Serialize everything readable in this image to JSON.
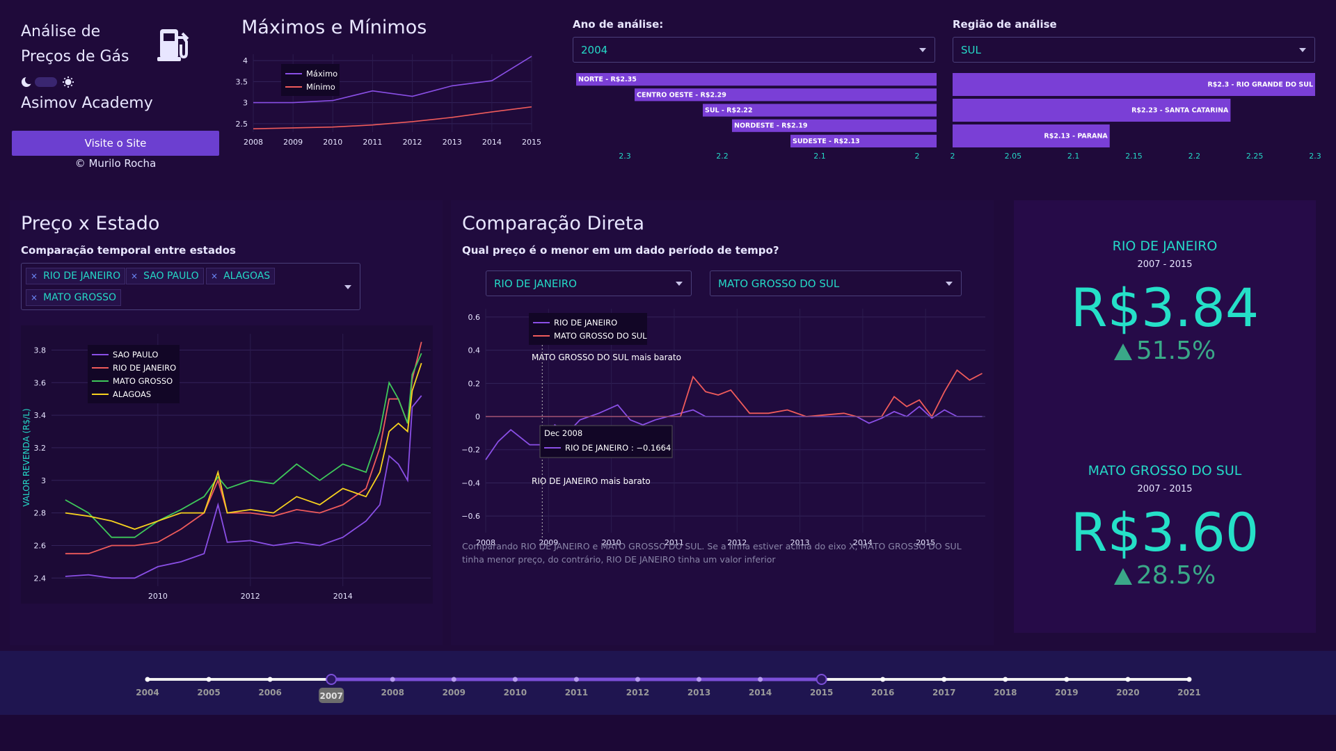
{
  "app": {
    "title": "Análise de Preços de Gás",
    "title_line1": "Análise de",
    "title_line2": "Preços de Gás",
    "academy": "Asimov Academy",
    "visit_button": "Visite o Site",
    "credit": "© Murilo Rocha",
    "icons": [
      "fuel-pump-icon",
      "moon-icon",
      "sun-icon"
    ]
  },
  "colors": {
    "purple": "#8a4fe6",
    "coral": "#ef5b5b",
    "green": "#3ec85a",
    "yellow": "#f7d21e",
    "teal": "#25d9c7",
    "bar": "#7a3fd6"
  },
  "maxmin": {
    "title": "Máximos e Mínimos"
  },
  "ano": {
    "label": "Ano de análise:",
    "value": "2004"
  },
  "regiao": {
    "label": "Região de análise",
    "value": "SUL"
  },
  "preco_estado": {
    "title": "Preço x Estado",
    "subtitle": "Comparação temporal entre estados",
    "chips": [
      "RIO DE JANEIRO",
      "SAO PAULO",
      "ALAGOAS",
      "MATO GROSSO"
    ],
    "chip_remove": "×"
  },
  "comparacao": {
    "title": "Comparação Direta",
    "subtitle": "Qual preço é o menor em um dado período de tempo?",
    "state_a": "RIO DE JANEIRO",
    "state_b": "MATO GROSSO DO SUL",
    "caption": "Comparando RIO DE JANEIRO e MATO GROSSO DO SUL. Se a linha estiver acima do eixo X, MATO GROSSO DO SUL tinha menor preço, do contrário, RIO DE JANEIRO tinha um valor inferior",
    "note_top": "MATO GROSSO DO SUL mais barato",
    "note_bottom": "RIO DE JANEIRO mais barato",
    "tooltip_date": "Dec 2008",
    "tooltip_value": "RIO DE JANEIRO : −0.1664"
  },
  "kpi": [
    {
      "name": "RIO DE JANEIRO",
      "years": "2007 - 2015",
      "value": "R$3.84",
      "delta": "51.5%"
    },
    {
      "name": "MATO GROSSO DO SUL",
      "years": "2007 - 2015",
      "value": "R$3.60",
      "delta": "28.5%"
    }
  ],
  "slider": {
    "years": [
      "2004",
      "2005",
      "2006",
      "2007",
      "2008",
      "2009",
      "2010",
      "2011",
      "2012",
      "2013",
      "2014",
      "2015",
      "2016",
      "2017",
      "2018",
      "2019",
      "2020",
      "2021"
    ],
    "range": [
      "2007",
      "2015"
    ]
  },
  "chart_data": [
    {
      "id": "maxmin",
      "type": "line",
      "title": "Máximos e Mínimos",
      "x": [
        2008,
        2009,
        2010,
        2011,
        2012,
        2013,
        2014,
        2015
      ],
      "series": [
        {
          "name": "Máximo",
          "values": [
            3.0,
            3.0,
            3.05,
            3.28,
            3.15,
            3.4,
            3.52,
            4.1
          ]
        },
        {
          "name": "Mínimo",
          "values": [
            2.38,
            2.4,
            2.42,
            2.47,
            2.55,
            2.65,
            2.78,
            2.9
          ]
        }
      ],
      "xlim": [
        2008,
        2015
      ],
      "ylim": [
        2.3,
        4.15
      ],
      "yticks": [
        2.5,
        3,
        3.5,
        4
      ],
      "xticks": [
        2008,
        2009,
        2010,
        2011,
        2012,
        2013,
        2014,
        2015
      ],
      "legend": "top-left",
      "grid": true
    },
    {
      "id": "ano_bars",
      "type": "bar",
      "orientation": "horizontal",
      "categories": [
        "NORTE - R$2.35",
        "CENTRO OESTE - R$2.29",
        "SUL - R$2.22",
        "NORDESTE - R$2.19",
        "SUDESTE - R$2.13"
      ],
      "values": [
        2.35,
        2.29,
        2.22,
        2.19,
        2.13
      ],
      "xlim": [
        2.35,
        1.98
      ],
      "xticks": [
        2.3,
        2.2,
        2.1,
        2
      ],
      "xtick_labels": [
        "2.3",
        "2.2",
        "2.1",
        "2"
      ]
    },
    {
      "id": "regiao_bars",
      "type": "bar",
      "orientation": "horizontal",
      "categories": [
        "R$2.3 - RIO GRANDE DO SUL",
        "R$2.23 - SANTA CATARINA",
        "R$2.13 - PARANA"
      ],
      "values": [
        2.3,
        2.23,
        2.13
      ],
      "xlim": [
        2.0,
        2.3
      ],
      "xticks": [
        2,
        2.05,
        2.1,
        2.15,
        2.2,
        2.25,
        2.3
      ],
      "xtick_labels": [
        "2",
        "2.05",
        "2.1",
        "2.15",
        "2.2",
        "2.25",
        "2.3"
      ]
    },
    {
      "id": "preco_estado",
      "type": "line",
      "ylabel": "VALOR REVENDA (R$/L)",
      "x": [
        2008.0,
        2008.5,
        2009.0,
        2009.5,
        2010.0,
        2010.5,
        2011.0,
        2011.3,
        2011.5,
        2012.0,
        2012.5,
        2013.0,
        2013.5,
        2014.0,
        2014.5,
        2014.8,
        2015.0,
        2015.2,
        2015.4,
        2015.5,
        2015.7
      ],
      "series": [
        {
          "name": "SAO PAULO",
          "values": [
            2.41,
            2.42,
            2.4,
            2.4,
            2.47,
            2.5,
            2.55,
            2.85,
            2.62,
            2.63,
            2.6,
            2.62,
            2.6,
            2.65,
            2.75,
            2.85,
            3.15,
            3.1,
            3.0,
            3.45,
            3.52
          ]
        },
        {
          "name": "RIO DE JANEIRO",
          "values": [
            2.55,
            2.55,
            2.6,
            2.6,
            2.62,
            2.7,
            2.8,
            3.0,
            2.8,
            2.8,
            2.78,
            2.82,
            2.8,
            2.85,
            2.95,
            3.2,
            3.5,
            3.5,
            3.35,
            3.62,
            3.85
          ]
        },
        {
          "name": "MATO GROSSO",
          "values": [
            2.88,
            2.8,
            2.65,
            2.65,
            2.75,
            2.82,
            2.9,
            3.02,
            2.95,
            3.0,
            2.98,
            3.1,
            3.0,
            3.1,
            3.05,
            3.3,
            3.6,
            3.5,
            3.35,
            3.65,
            3.78
          ]
        },
        {
          "name": "ALAGOAS",
          "values": [
            2.8,
            2.78,
            2.75,
            2.7,
            2.75,
            2.8,
            2.8,
            3.05,
            2.8,
            2.82,
            2.8,
            2.9,
            2.85,
            2.95,
            2.9,
            3.05,
            3.3,
            3.35,
            3.3,
            3.55,
            3.72
          ]
        }
      ],
      "xlim": [
        2007.7,
        2015.9
      ],
      "ylim": [
        2.35,
        3.9
      ],
      "yticks": [
        2.4,
        2.6,
        2.8,
        3,
        3.2,
        3.4,
        3.6,
        3.8
      ],
      "xticks": [
        2010,
        2012,
        2014
      ],
      "legend": "top-left",
      "grid": true
    },
    {
      "id": "comparacao",
      "type": "line",
      "x": [
        2008.0,
        2008.2,
        2008.4,
        2008.7,
        2008.9,
        2009.1,
        2009.3,
        2009.5,
        2009.8,
        2010.1,
        2010.3,
        2010.5,
        2010.7,
        2010.9,
        2011.1,
        2011.3,
        2011.5,
        2011.7,
        2011.9,
        2012.2,
        2012.5,
        2012.8,
        2013.1,
        2013.4,
        2013.7,
        2013.9,
        2014.1,
        2014.3,
        2014.5,
        2014.7,
        2014.9,
        2015.1,
        2015.3,
        2015.5,
        2015.7,
        2015.9
      ],
      "series": [
        {
          "name": "RIO DE JANEIRO",
          "values": [
            -0.26,
            -0.15,
            -0.08,
            -0.17,
            -0.17,
            -0.05,
            -0.1,
            -0.02,
            0.02,
            0.07,
            -0.02,
            -0.05,
            -0.02,
            0.0,
            0.02,
            0.04,
            0.0,
            0.0,
            0.0,
            0.0,
            0.0,
            0.0,
            0.0,
            0.0,
            0.0,
            0.0,
            -0.04,
            -0.01,
            0.03,
            0.0,
            0.06,
            -0.01,
            0.04,
            0.0,
            0.0,
            0.0
          ]
        },
        {
          "name": "MATO GROSSO DO SUL",
          "values": [
            0.0,
            0.0,
            0.0,
            0.0,
            0.0,
            0.0,
            0.0,
            0.0,
            0.0,
            0.0,
            0.0,
            0.0,
            0.0,
            0.0,
            0.0,
            0.24,
            0.15,
            0.13,
            0.16,
            0.02,
            0.02,
            0.04,
            0.0,
            0.01,
            0.02,
            0.0,
            0.0,
            0.0,
            0.12,
            0.06,
            0.1,
            0.0,
            0.15,
            0.28,
            0.22,
            0.26
          ]
        }
      ],
      "xlim": [
        2008.0,
        2015.95
      ],
      "ylim": [
        -0.7,
        0.65
      ],
      "yticks": [
        -0.6,
        -0.4,
        -0.2,
        0,
        0.2,
        0.4,
        0.6
      ],
      "xticks": [
        2008,
        2009,
        2010,
        2011,
        2012,
        2013,
        2014,
        2015
      ],
      "legend": "top-left",
      "grid": true
    }
  ]
}
